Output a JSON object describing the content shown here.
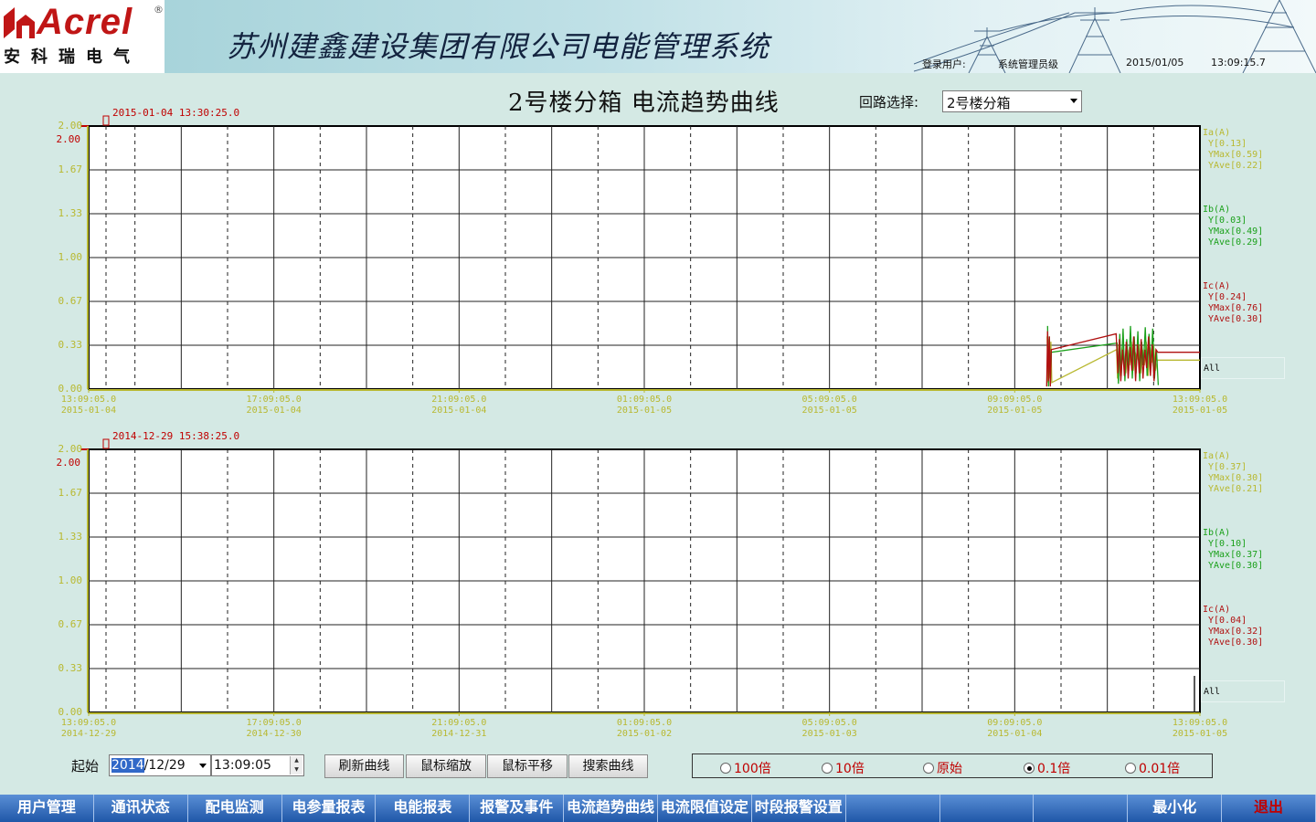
{
  "header": {
    "logo_text": "Acrel",
    "logo_reg": "®",
    "logo_cn": "安科瑞电气",
    "app_title": "苏州建鑫建设集团有限公司电能管理系统",
    "login_label": "登录用户:",
    "user_role": "系统管理员级",
    "date": "2015/01/05",
    "time": "13:09:15.7"
  },
  "page": {
    "title": "2号楼分箱 电流趋势曲线",
    "circuit_label": "回路选择:",
    "circuit_value": "2号楼分箱"
  },
  "colors": {
    "ia": "#b8b830",
    "ib": "#1aa01a",
    "ic": "#b01010",
    "axis": "#b8b830",
    "nav": "#2a64b8"
  },
  "chart_data": [
    {
      "type": "line",
      "cursor_time": "2015-01-04 13:30:25.0",
      "y_max_label": "2.00",
      "y_ticks": [
        "2.00",
        "1.67",
        "1.33",
        "1.00",
        "0.67",
        "0.33",
        "0.00"
      ],
      "ylim": [
        0,
        2
      ],
      "x_ticks": [
        {
          "time": "13:09:05.0",
          "date": "2015-01-04"
        },
        {
          "time": "17:09:05.0",
          "date": "2015-01-04"
        },
        {
          "time": "21:09:05.0",
          "date": "2015-01-04"
        },
        {
          "time": "01:09:05.0",
          "date": "2015-01-05"
        },
        {
          "time": "05:09:05.0",
          "date": "2015-01-05"
        },
        {
          "time": "09:09:05.0",
          "date": "2015-01-05"
        },
        {
          "time": "13:09:05.0",
          "date": "2015-01-05"
        }
      ],
      "legend": [
        {
          "name": "Ia(A)",
          "y": "Y[0.13]",
          "ymax": "YMax[0.59]",
          "yave": "YAve[0.22]"
        },
        {
          "name": "Ib(A)",
          "y": "Y[0.03]",
          "ymax": "YMax[0.49]",
          "yave": "YAve[0.29]"
        },
        {
          "name": "Ic(A)",
          "y": "Y[0.24]",
          "ymax": "YMax[0.76]",
          "yave": "YAve[0.30]"
        }
      ],
      "all_label": "All",
      "series": [
        {
          "name": "Ia(A)",
          "x": [
            20.7,
            20.72,
            20.74,
            20.76,
            20.78,
            20.8,
            22.2,
            22.22,
            22.25,
            22.28,
            22.32,
            22.36,
            22.4,
            22.44,
            22.48,
            22.52,
            22.56,
            22.6,
            22.64,
            22.68,
            22.72,
            22.76,
            22.8,
            22.84,
            22.88,
            22.92,
            22.96,
            23.0,
            23.04,
            23.08,
            24.0
          ],
          "y": [
            0.4,
            0.05,
            0.38,
            0.08,
            0.36,
            0.05,
            0.3,
            0.08,
            0.34,
            0.1,
            0.32,
            0.2,
            0.12,
            0.3,
            0.18,
            0.36,
            0.14,
            0.28,
            0.22,
            0.34,
            0.12,
            0.3,
            0.18,
            0.36,
            0.1,
            0.32,
            0.2,
            0.34,
            0.14,
            0.22,
            0.22
          ]
        },
        {
          "name": "Ib(A)",
          "x": [
            20.71,
            20.73,
            20.75,
            20.77,
            20.79,
            22.21,
            22.24,
            22.27,
            22.3,
            22.34,
            22.38,
            22.42,
            22.46,
            22.5,
            22.54,
            22.58,
            22.62,
            22.66,
            22.7,
            22.74,
            22.78,
            22.82,
            22.86,
            22.9,
            22.94,
            22.98,
            23.02,
            23.06,
            23.1
          ],
          "y": [
            0.48,
            0.02,
            0.4,
            0.03,
            0.28,
            0.35,
            0.04,
            0.42,
            0.1,
            0.46,
            0.06,
            0.38,
            0.14,
            0.48,
            0.08,
            0.4,
            0.12,
            0.44,
            0.06,
            0.36,
            0.18,
            0.47,
            0.1,
            0.42,
            0.16,
            0.46,
            0.08,
            0.3,
            0.03
          ]
        },
        {
          "name": "Ic(A)",
          "x": [
            20.69,
            20.71,
            20.73,
            20.75,
            20.77,
            20.79,
            22.19,
            22.23,
            22.26,
            22.29,
            22.33,
            22.37,
            22.41,
            22.45,
            22.49,
            22.53,
            22.57,
            22.61,
            22.65,
            22.69,
            22.73,
            22.77,
            22.81,
            22.85,
            22.89,
            22.93,
            22.97,
            23.01,
            23.05,
            23.09,
            24.0
          ],
          "y": [
            0.02,
            0.44,
            0.06,
            0.4,
            0.02,
            0.3,
            0.42,
            0.12,
            0.38,
            0.06,
            0.3,
            0.1,
            0.36,
            0.08,
            0.32,
            0.14,
            0.4,
            0.06,
            0.34,
            0.12,
            0.38,
            0.08,
            0.3,
            0.16,
            0.4,
            0.1,
            0.34,
            0.06,
            0.3,
            0.28,
            0.28
          ]
        }
      ]
    },
    {
      "type": "line",
      "cursor_time": "2014-12-29 15:38:25.0",
      "y_max_label": "2.00",
      "y_ticks": [
        "2.00",
        "1.67",
        "1.33",
        "1.00",
        "0.67",
        "0.33",
        "0.00"
      ],
      "ylim": [
        0,
        2
      ],
      "x_ticks": [
        {
          "time": "13:09:05.0",
          "date": "2014-12-29"
        },
        {
          "time": "17:09:05.0",
          "date": "2014-12-30"
        },
        {
          "time": "21:09:05.0",
          "date": "2014-12-31"
        },
        {
          "time": "01:09:05.0",
          "date": "2015-01-02"
        },
        {
          "time": "05:09:05.0",
          "date": "2015-01-03"
        },
        {
          "time": "09:09:05.0",
          "date": "2015-01-04"
        },
        {
          "time": "13:09:05.0",
          "date": "2015-01-05"
        }
      ],
      "legend": [
        {
          "name": "Ia(A)",
          "y": "Y[0.37]",
          "ymax": "YMax[0.30]",
          "yave": "YAve[0.21]"
        },
        {
          "name": "Ib(A)",
          "y": "Y[0.10]",
          "ymax": "YMax[0.37]",
          "yave": "YAve[0.30]"
        },
        {
          "name": "Ic(A)",
          "y": "Y[0.04]",
          "ymax": "YMax[0.32]",
          "yave": "YAve[0.30]"
        }
      ],
      "all_label": "All",
      "series": [
        {
          "name": "Ia(A)",
          "x": [],
          "y": []
        },
        {
          "name": "Ib(A)",
          "x": [],
          "y": []
        },
        {
          "name": "Ic(A)",
          "x": [],
          "y": []
        }
      ]
    }
  ],
  "controls": {
    "start_label": "起始",
    "date_year": "2014",
    "date_rest": "/12/29",
    "time_value": "13:09:05",
    "buttons": [
      "刷新曲线",
      "鼠标缩放",
      "鼠标平移",
      "搜索曲线"
    ],
    "scales": [
      "100倍",
      "10倍",
      "原始",
      "0.1倍",
      "0.01倍"
    ],
    "selected_scale": 3
  },
  "nav": {
    "items": [
      "用户管理",
      "通讯状态",
      "配电监测",
      "电参量报表",
      "电能报表",
      "报警及事件",
      "电流趋势曲线",
      "电流限值设定",
      "时段报警设置",
      "",
      "",
      "",
      "最小化",
      "",
      "退出"
    ]
  }
}
